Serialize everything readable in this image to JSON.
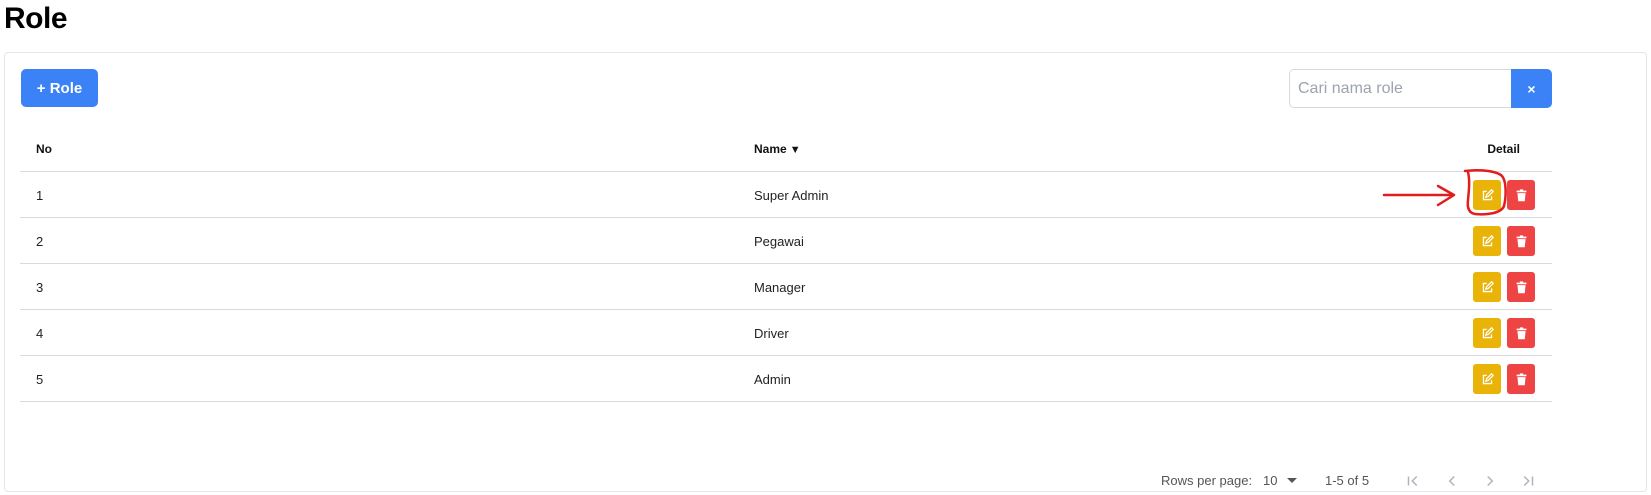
{
  "page": {
    "title": "Role"
  },
  "toolbar": {
    "add_label": "+ Role"
  },
  "search": {
    "placeholder": "Cari nama role",
    "value": "",
    "clear_label": "×"
  },
  "table": {
    "headers": {
      "no": "No",
      "name": "Name",
      "detail": "Detail",
      "sort_indicator": "▼"
    },
    "rows": [
      {
        "no": "1",
        "name": "Super Admin"
      },
      {
        "no": "2",
        "name": "Pegawai"
      },
      {
        "no": "3",
        "name": "Manager"
      },
      {
        "no": "4",
        "name": "Driver"
      },
      {
        "no": "5",
        "name": "Admin"
      }
    ]
  },
  "pagination": {
    "rows_per_page_label": "Rows per page:",
    "rows_per_page_value": "10",
    "range_text": "1-5 of 5"
  },
  "icons": {
    "edit": "edit-icon",
    "delete": "trash-icon",
    "first": "first-page-icon",
    "prev": "chevron-left-icon",
    "next": "chevron-right-icon",
    "last": "last-page-icon"
  },
  "colors": {
    "primary": "#3b82f6",
    "edit": "#eab308",
    "delete": "#ef4444",
    "annotation": "#e11d1d"
  }
}
